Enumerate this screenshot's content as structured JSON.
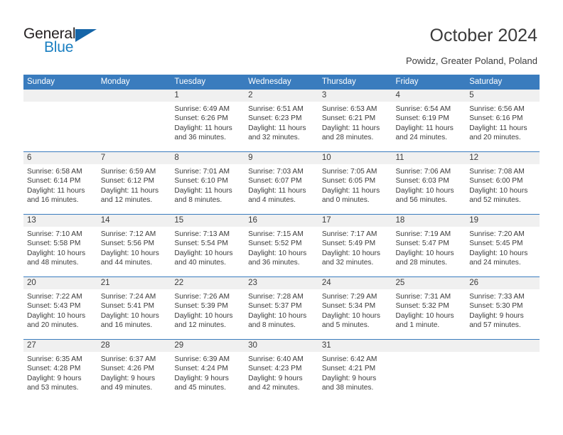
{
  "brand": {
    "logo_icon": "general-blue-logo",
    "word_general": "General",
    "word_blue": "Blue"
  },
  "header": {
    "title": "October 2024",
    "location": "Powidz, Greater Poland, Poland"
  },
  "colors": {
    "header_blue": "#3a7cbe",
    "brand_blue": "#1a7fc1",
    "daynum_band": "#f0f0f0",
    "text": "#3b3b3b"
  },
  "calendar": {
    "weekday_headers": [
      "Sunday",
      "Monday",
      "Tuesday",
      "Wednesday",
      "Thursday",
      "Friday",
      "Saturday"
    ],
    "weeks": [
      [
        {
          "day": "",
          "empty": true
        },
        {
          "day": "",
          "empty": true
        },
        {
          "day": "1",
          "sunrise": "Sunrise: 6:49 AM",
          "sunset": "Sunset: 6:26 PM",
          "daylight": "Daylight: 11 hours and 36 minutes."
        },
        {
          "day": "2",
          "sunrise": "Sunrise: 6:51 AM",
          "sunset": "Sunset: 6:23 PM",
          "daylight": "Daylight: 11 hours and 32 minutes."
        },
        {
          "day": "3",
          "sunrise": "Sunrise: 6:53 AM",
          "sunset": "Sunset: 6:21 PM",
          "daylight": "Daylight: 11 hours and 28 minutes."
        },
        {
          "day": "4",
          "sunrise": "Sunrise: 6:54 AM",
          "sunset": "Sunset: 6:19 PM",
          "daylight": "Daylight: 11 hours and 24 minutes."
        },
        {
          "day": "5",
          "sunrise": "Sunrise: 6:56 AM",
          "sunset": "Sunset: 6:16 PM",
          "daylight": "Daylight: 11 hours and 20 minutes."
        }
      ],
      [
        {
          "day": "6",
          "sunrise": "Sunrise: 6:58 AM",
          "sunset": "Sunset: 6:14 PM",
          "daylight": "Daylight: 11 hours and 16 minutes."
        },
        {
          "day": "7",
          "sunrise": "Sunrise: 6:59 AM",
          "sunset": "Sunset: 6:12 PM",
          "daylight": "Daylight: 11 hours and 12 minutes."
        },
        {
          "day": "8",
          "sunrise": "Sunrise: 7:01 AM",
          "sunset": "Sunset: 6:10 PM",
          "daylight": "Daylight: 11 hours and 8 minutes."
        },
        {
          "day": "9",
          "sunrise": "Sunrise: 7:03 AM",
          "sunset": "Sunset: 6:07 PM",
          "daylight": "Daylight: 11 hours and 4 minutes."
        },
        {
          "day": "10",
          "sunrise": "Sunrise: 7:05 AM",
          "sunset": "Sunset: 6:05 PM",
          "daylight": "Daylight: 11 hours and 0 minutes."
        },
        {
          "day": "11",
          "sunrise": "Sunrise: 7:06 AM",
          "sunset": "Sunset: 6:03 PM",
          "daylight": "Daylight: 10 hours and 56 minutes."
        },
        {
          "day": "12",
          "sunrise": "Sunrise: 7:08 AM",
          "sunset": "Sunset: 6:00 PM",
          "daylight": "Daylight: 10 hours and 52 minutes."
        }
      ],
      [
        {
          "day": "13",
          "sunrise": "Sunrise: 7:10 AM",
          "sunset": "Sunset: 5:58 PM",
          "daylight": "Daylight: 10 hours and 48 minutes."
        },
        {
          "day": "14",
          "sunrise": "Sunrise: 7:12 AM",
          "sunset": "Sunset: 5:56 PM",
          "daylight": "Daylight: 10 hours and 44 minutes."
        },
        {
          "day": "15",
          "sunrise": "Sunrise: 7:13 AM",
          "sunset": "Sunset: 5:54 PM",
          "daylight": "Daylight: 10 hours and 40 minutes."
        },
        {
          "day": "16",
          "sunrise": "Sunrise: 7:15 AM",
          "sunset": "Sunset: 5:52 PM",
          "daylight": "Daylight: 10 hours and 36 minutes."
        },
        {
          "day": "17",
          "sunrise": "Sunrise: 7:17 AM",
          "sunset": "Sunset: 5:49 PM",
          "daylight": "Daylight: 10 hours and 32 minutes."
        },
        {
          "day": "18",
          "sunrise": "Sunrise: 7:19 AM",
          "sunset": "Sunset: 5:47 PM",
          "daylight": "Daylight: 10 hours and 28 minutes."
        },
        {
          "day": "19",
          "sunrise": "Sunrise: 7:20 AM",
          "sunset": "Sunset: 5:45 PM",
          "daylight": "Daylight: 10 hours and 24 minutes."
        }
      ],
      [
        {
          "day": "20",
          "sunrise": "Sunrise: 7:22 AM",
          "sunset": "Sunset: 5:43 PM",
          "daylight": "Daylight: 10 hours and 20 minutes."
        },
        {
          "day": "21",
          "sunrise": "Sunrise: 7:24 AM",
          "sunset": "Sunset: 5:41 PM",
          "daylight": "Daylight: 10 hours and 16 minutes."
        },
        {
          "day": "22",
          "sunrise": "Sunrise: 7:26 AM",
          "sunset": "Sunset: 5:39 PM",
          "daylight": "Daylight: 10 hours and 12 minutes."
        },
        {
          "day": "23",
          "sunrise": "Sunrise: 7:28 AM",
          "sunset": "Sunset: 5:37 PM",
          "daylight": "Daylight: 10 hours and 8 minutes."
        },
        {
          "day": "24",
          "sunrise": "Sunrise: 7:29 AM",
          "sunset": "Sunset: 5:34 PM",
          "daylight": "Daylight: 10 hours and 5 minutes."
        },
        {
          "day": "25",
          "sunrise": "Sunrise: 7:31 AM",
          "sunset": "Sunset: 5:32 PM",
          "daylight": "Daylight: 10 hours and 1 minute."
        },
        {
          "day": "26",
          "sunrise": "Sunrise: 7:33 AM",
          "sunset": "Sunset: 5:30 PM",
          "daylight": "Daylight: 9 hours and 57 minutes."
        }
      ],
      [
        {
          "day": "27",
          "sunrise": "Sunrise: 6:35 AM",
          "sunset": "Sunset: 4:28 PM",
          "daylight": "Daylight: 9 hours and 53 minutes."
        },
        {
          "day": "28",
          "sunrise": "Sunrise: 6:37 AM",
          "sunset": "Sunset: 4:26 PM",
          "daylight": "Daylight: 9 hours and 49 minutes."
        },
        {
          "day": "29",
          "sunrise": "Sunrise: 6:39 AM",
          "sunset": "Sunset: 4:24 PM",
          "daylight": "Daylight: 9 hours and 45 minutes."
        },
        {
          "day": "30",
          "sunrise": "Sunrise: 6:40 AM",
          "sunset": "Sunset: 4:23 PM",
          "daylight": "Daylight: 9 hours and 42 minutes."
        },
        {
          "day": "31",
          "sunrise": "Sunrise: 6:42 AM",
          "sunset": "Sunset: 4:21 PM",
          "daylight": "Daylight: 9 hours and 38 minutes."
        },
        {
          "day": "",
          "empty": true
        },
        {
          "day": "",
          "empty": true
        }
      ]
    ]
  }
}
